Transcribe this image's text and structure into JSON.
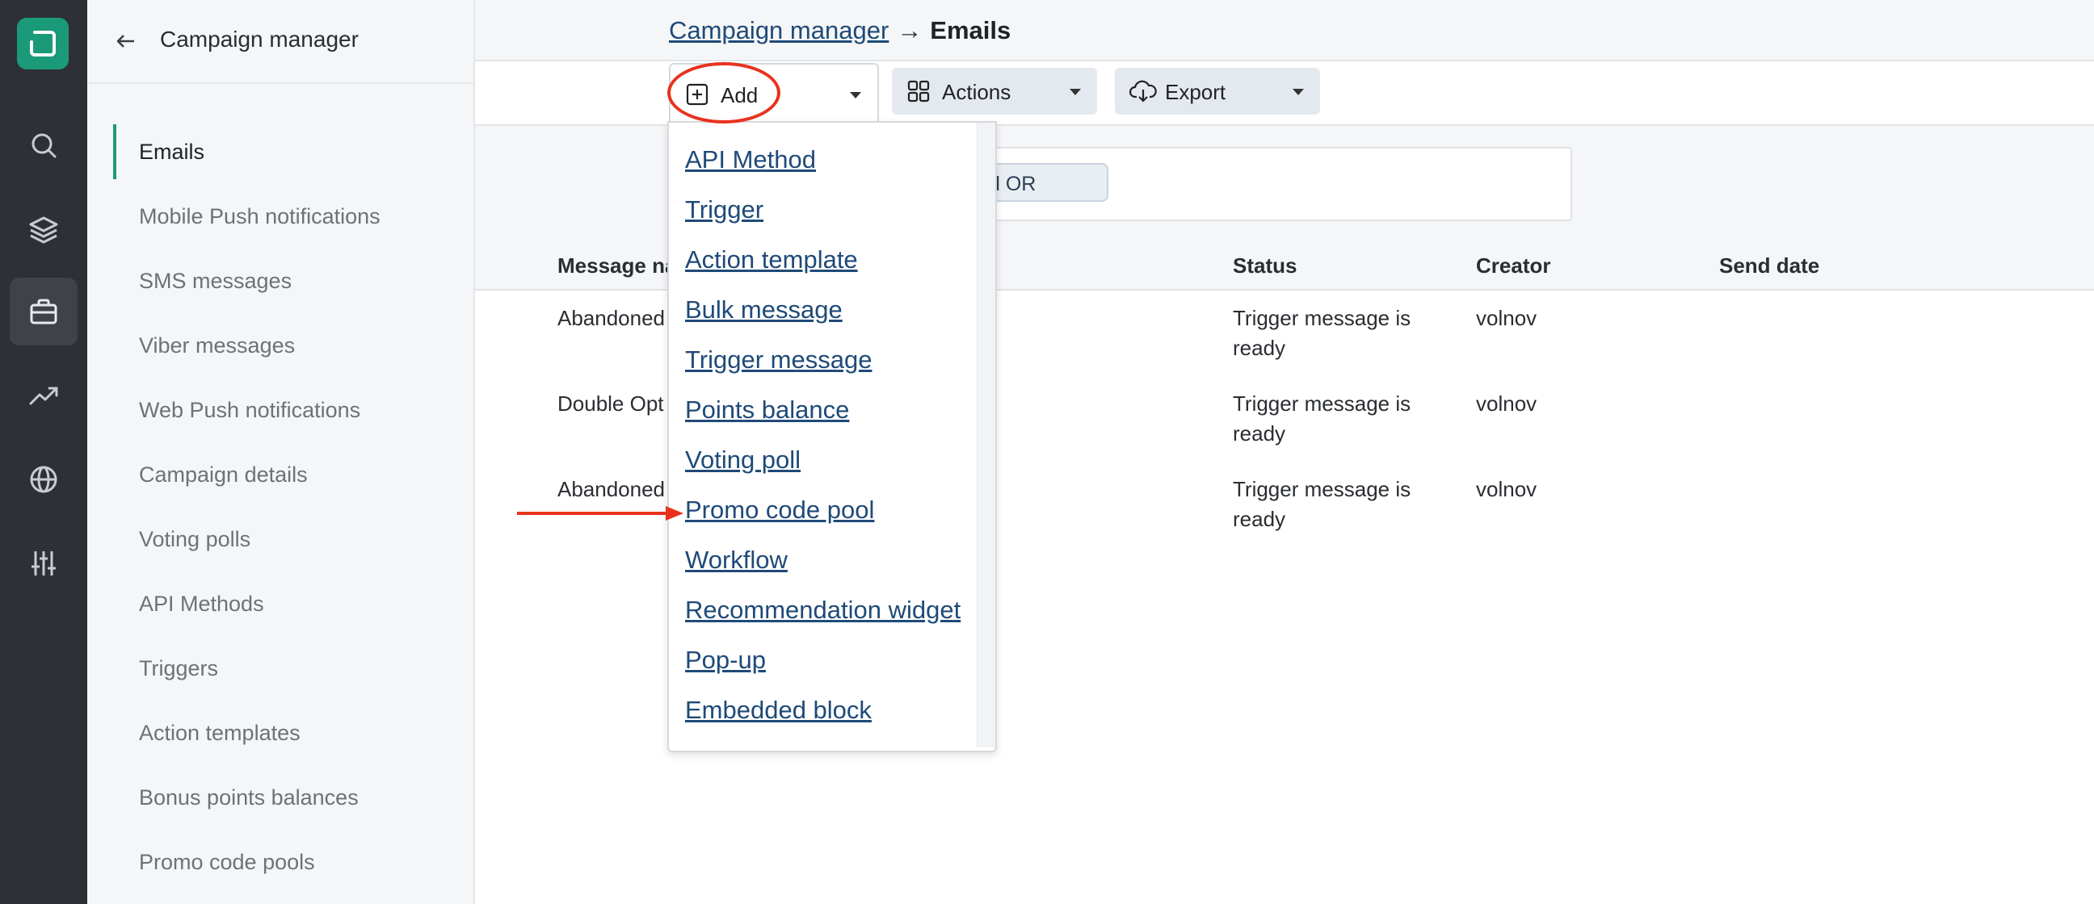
{
  "subnav": {
    "title": "Campaign manager",
    "items": [
      {
        "label": "Emails"
      },
      {
        "label": "Mobile Push notifications"
      },
      {
        "label": "SMS messages"
      },
      {
        "label": "Viber messages"
      },
      {
        "label": "Web Push notifications"
      },
      {
        "label": "Campaign details"
      },
      {
        "label": "Voting polls"
      },
      {
        "label": "API Methods"
      },
      {
        "label": "Triggers"
      },
      {
        "label": "Action templates"
      },
      {
        "label": "Bonus points balances"
      },
      {
        "label": "Promo code pools"
      }
    ]
  },
  "rail": {
    "icons": [
      "logo-icon",
      "search-icon",
      "layers-icon",
      "briefcase-icon",
      "trending-icon",
      "globe-icon",
      "settings-sliders-icon"
    ]
  },
  "breadcrumb": {
    "parent": "Campaign manager",
    "separator": "→",
    "current": "Emails"
  },
  "toolbar": {
    "add_label": "Add",
    "actions_label": "Actions",
    "export_label": "Export"
  },
  "filter": {
    "chip_text": "d OR"
  },
  "table": {
    "headers": {
      "name": "Message na",
      "status": "Status",
      "creator": "Creator",
      "send_date": "Send date"
    },
    "rows": [
      {
        "name": "Abandoned",
        "status_line1": "Trigger message is",
        "status_line2": "ready",
        "creator": "volnov"
      },
      {
        "name": "Double Opt",
        "status_line1": "Trigger message is",
        "status_line2": "ready",
        "creator": "volnov"
      },
      {
        "name": "Abandoned",
        "status_line1": "Trigger message is",
        "status_line2": "ready",
        "creator": "volnov"
      }
    ]
  },
  "dropdown": {
    "items": [
      "API Method",
      "Trigger",
      "Action template",
      "Bulk message",
      "Trigger message",
      "Points balance",
      "Voting poll",
      "Promo code pool",
      "Workflow",
      "Recommendation widget",
      "Pop-up",
      "Embedded block"
    ]
  },
  "colors": {
    "accent": "#1a9a78",
    "rail": "#2d3035",
    "link": "#1f4a78",
    "annotation": "#e8321e"
  }
}
